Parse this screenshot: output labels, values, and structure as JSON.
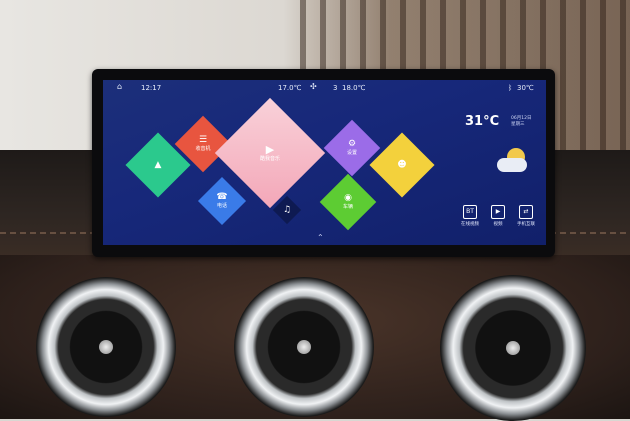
{
  "status_bar": {
    "time": "12:17",
    "temp_left": "17.0℃",
    "fan_level": "3",
    "temp_right": "18.0℃",
    "outside_temp": "30℃"
  },
  "tiles": [
    {
      "label": "导航",
      "glyph": "▲",
      "color": "#2bc98d",
      "icon": "navigation-icon"
    },
    {
      "label": "收音机",
      "glyph": "📻",
      "color": "#e8553f",
      "icon": "radio-icon"
    },
    {
      "label": "电话",
      "glyph": "☎",
      "color": "#3a7be8",
      "icon": "phone-icon"
    },
    {
      "label": "酷我音乐",
      "glyph": "▶",
      "color": "#f6b8c4",
      "icon": "music-player-icon"
    },
    {
      "label": "设置",
      "glyph": "⚙",
      "color": "#9b6ce8",
      "icon": "settings-icon"
    },
    {
      "label": "车辆",
      "glyph": "🚗",
      "color": "#5dcc33",
      "icon": "vehicle-icon"
    },
    {
      "label": "",
      "glyph": "👤",
      "color": "#f3d13c",
      "icon": "user-icon"
    }
  ],
  "weather": {
    "temp": "31°C",
    "date": "06月12日",
    "weekday": "星期三",
    "icon": "partly-cloudy-icon"
  },
  "shortcuts": [
    {
      "label": "在线视频",
      "icon": "online-video-icon",
      "glyph": "BT"
    },
    {
      "label": "视频",
      "icon": "video-icon",
      "glyph": "▶"
    },
    {
      "label": "手机互联",
      "icon": "phone-link-icon",
      "glyph": "⇄"
    }
  ]
}
